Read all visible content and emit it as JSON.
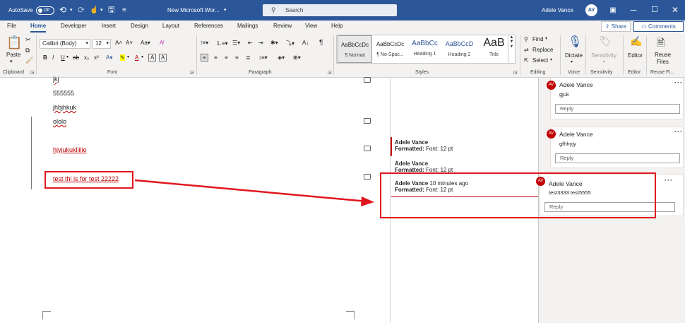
{
  "titlebar": {
    "autosave_label": "AutoSave",
    "autosave_state": "Off",
    "doc_title": "New Microsoft Wor...",
    "search_placeholder": "Search",
    "user_name": "Adele Vance",
    "user_initials": "AV"
  },
  "tabs": [
    "File",
    "Home",
    "Developer",
    "Insert",
    "Design",
    "Layout",
    "References",
    "Mailings",
    "Review",
    "View",
    "Help"
  ],
  "active_tab": "Home",
  "share_label": "Share",
  "comments_label": "Comments",
  "ribbon": {
    "paste_label": "Paste",
    "font_name": "Calibri (Body)",
    "font_size": "12",
    "styles": [
      {
        "preview": "AaBbCcDc",
        "name": "¶ Normal"
      },
      {
        "preview": "AaBbCcDc",
        "name": "¶ No Spac..."
      },
      {
        "preview": "AaBbCc",
        "name": "Heading 1"
      },
      {
        "preview": "AaBbCcD",
        "name": "Heading 2"
      },
      {
        "preview": "AaB",
        "name": "Title"
      }
    ],
    "find_label": "Find",
    "replace_label": "Replace",
    "select_label": "Select",
    "dictate_label": "Dictate",
    "sensitivity_label": "Sensitivity",
    "editor_label": "Editor",
    "reuse_label_1": "Reuse",
    "reuse_label_2": "Files",
    "groups": {
      "clipboard": "Clipboard",
      "font": "Font",
      "paragraph": "Paragraph",
      "styles": "Styles",
      "editing": "Editing",
      "voice": "Voice",
      "sensitivity": "Sensitivity",
      "editor": "Editor",
      "reuse": "Reuse Fi..."
    }
  },
  "document": {
    "lines": [
      "jkj",
      "555555",
      "jhbjhkuk",
      "ololo",
      "hjyjukukllilio",
      "test thi is for test 22222"
    ]
  },
  "markup_notes": [
    {
      "author": "Adele Vance",
      "time": "",
      "label": "Formatted:",
      "detail": "Font: 12 pt"
    },
    {
      "author": "Adele Vance",
      "time": "",
      "label": "Formatted:",
      "detail": "Font: 12 pt"
    },
    {
      "author": "Adele Vance",
      "time": "10 minutes ago",
      "label": "Formatted:",
      "detail": "Font: 12 pt"
    }
  ],
  "comments": [
    {
      "initials": "AV",
      "author": "Adele Vance",
      "text": "gjuk",
      "reply_placeholder": "Reply"
    },
    {
      "initials": "AV",
      "author": "Adele Vance",
      "text": "gfhhyjy",
      "reply_placeholder": "Reply"
    },
    {
      "initials": "AV",
      "author": "Adele Vance",
      "text": "test3333 test5555",
      "reply_placeholder": "Reply"
    }
  ],
  "colors": {
    "word_blue": "#2b579a",
    "annotation_red": "#e0161e",
    "revision_red": "#c00000"
  }
}
